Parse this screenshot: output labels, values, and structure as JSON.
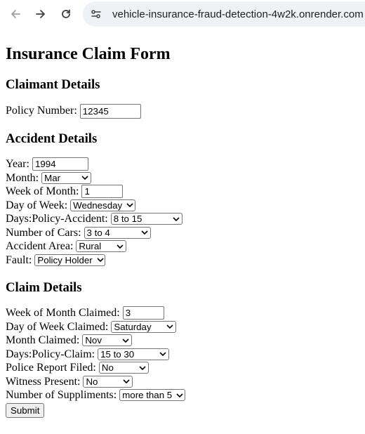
{
  "browser": {
    "url": "vehicle-insurance-fraud-detection-4w2k.onrender.com"
  },
  "page": {
    "title": "Insurance Claim Form"
  },
  "claimant": {
    "heading": "Claimant Details",
    "policy_number_label": "Policy Number:",
    "policy_number_value": "12345"
  },
  "accident": {
    "heading": "Accident Details",
    "year_label": "Year:",
    "year_value": "1994",
    "month_label": "Month:",
    "month_value": "Mar",
    "week_of_month_label": "Week of Month:",
    "week_of_month_value": "1",
    "day_of_week_label": "Day of Week:",
    "day_of_week_value": "Wednesday",
    "days_policy_accident_label": "Days:Policy-Accident:",
    "days_policy_accident_value": "8 to 15",
    "number_of_cars_label": "Number of Cars:",
    "number_of_cars_value": "3 to 4",
    "accident_area_label": "Accident Area:",
    "accident_area_value": "Rural",
    "fault_label": "Fault:",
    "fault_value": "Policy Holder"
  },
  "claim": {
    "heading": "Claim Details",
    "week_of_month_claimed_label": "Week of Month Claimed:",
    "week_of_month_claimed_value": "3",
    "day_of_week_claimed_label": "Day of Week Claimed:",
    "day_of_week_claimed_value": "Saturday",
    "month_claimed_label": "Month Claimed:",
    "month_claimed_value": "Nov",
    "days_policy_claim_label": "Days:Policy-Claim:",
    "days_policy_claim_value": "15 to 30",
    "police_report_label": "Police Report Filed:",
    "police_report_value": "No",
    "witness_present_label": "Witness Present:",
    "witness_present_value": "No",
    "number_of_suppliments_label": "Number of Suppliments:",
    "number_of_suppliments_value": "more than 5"
  },
  "submit_label": "Submit"
}
